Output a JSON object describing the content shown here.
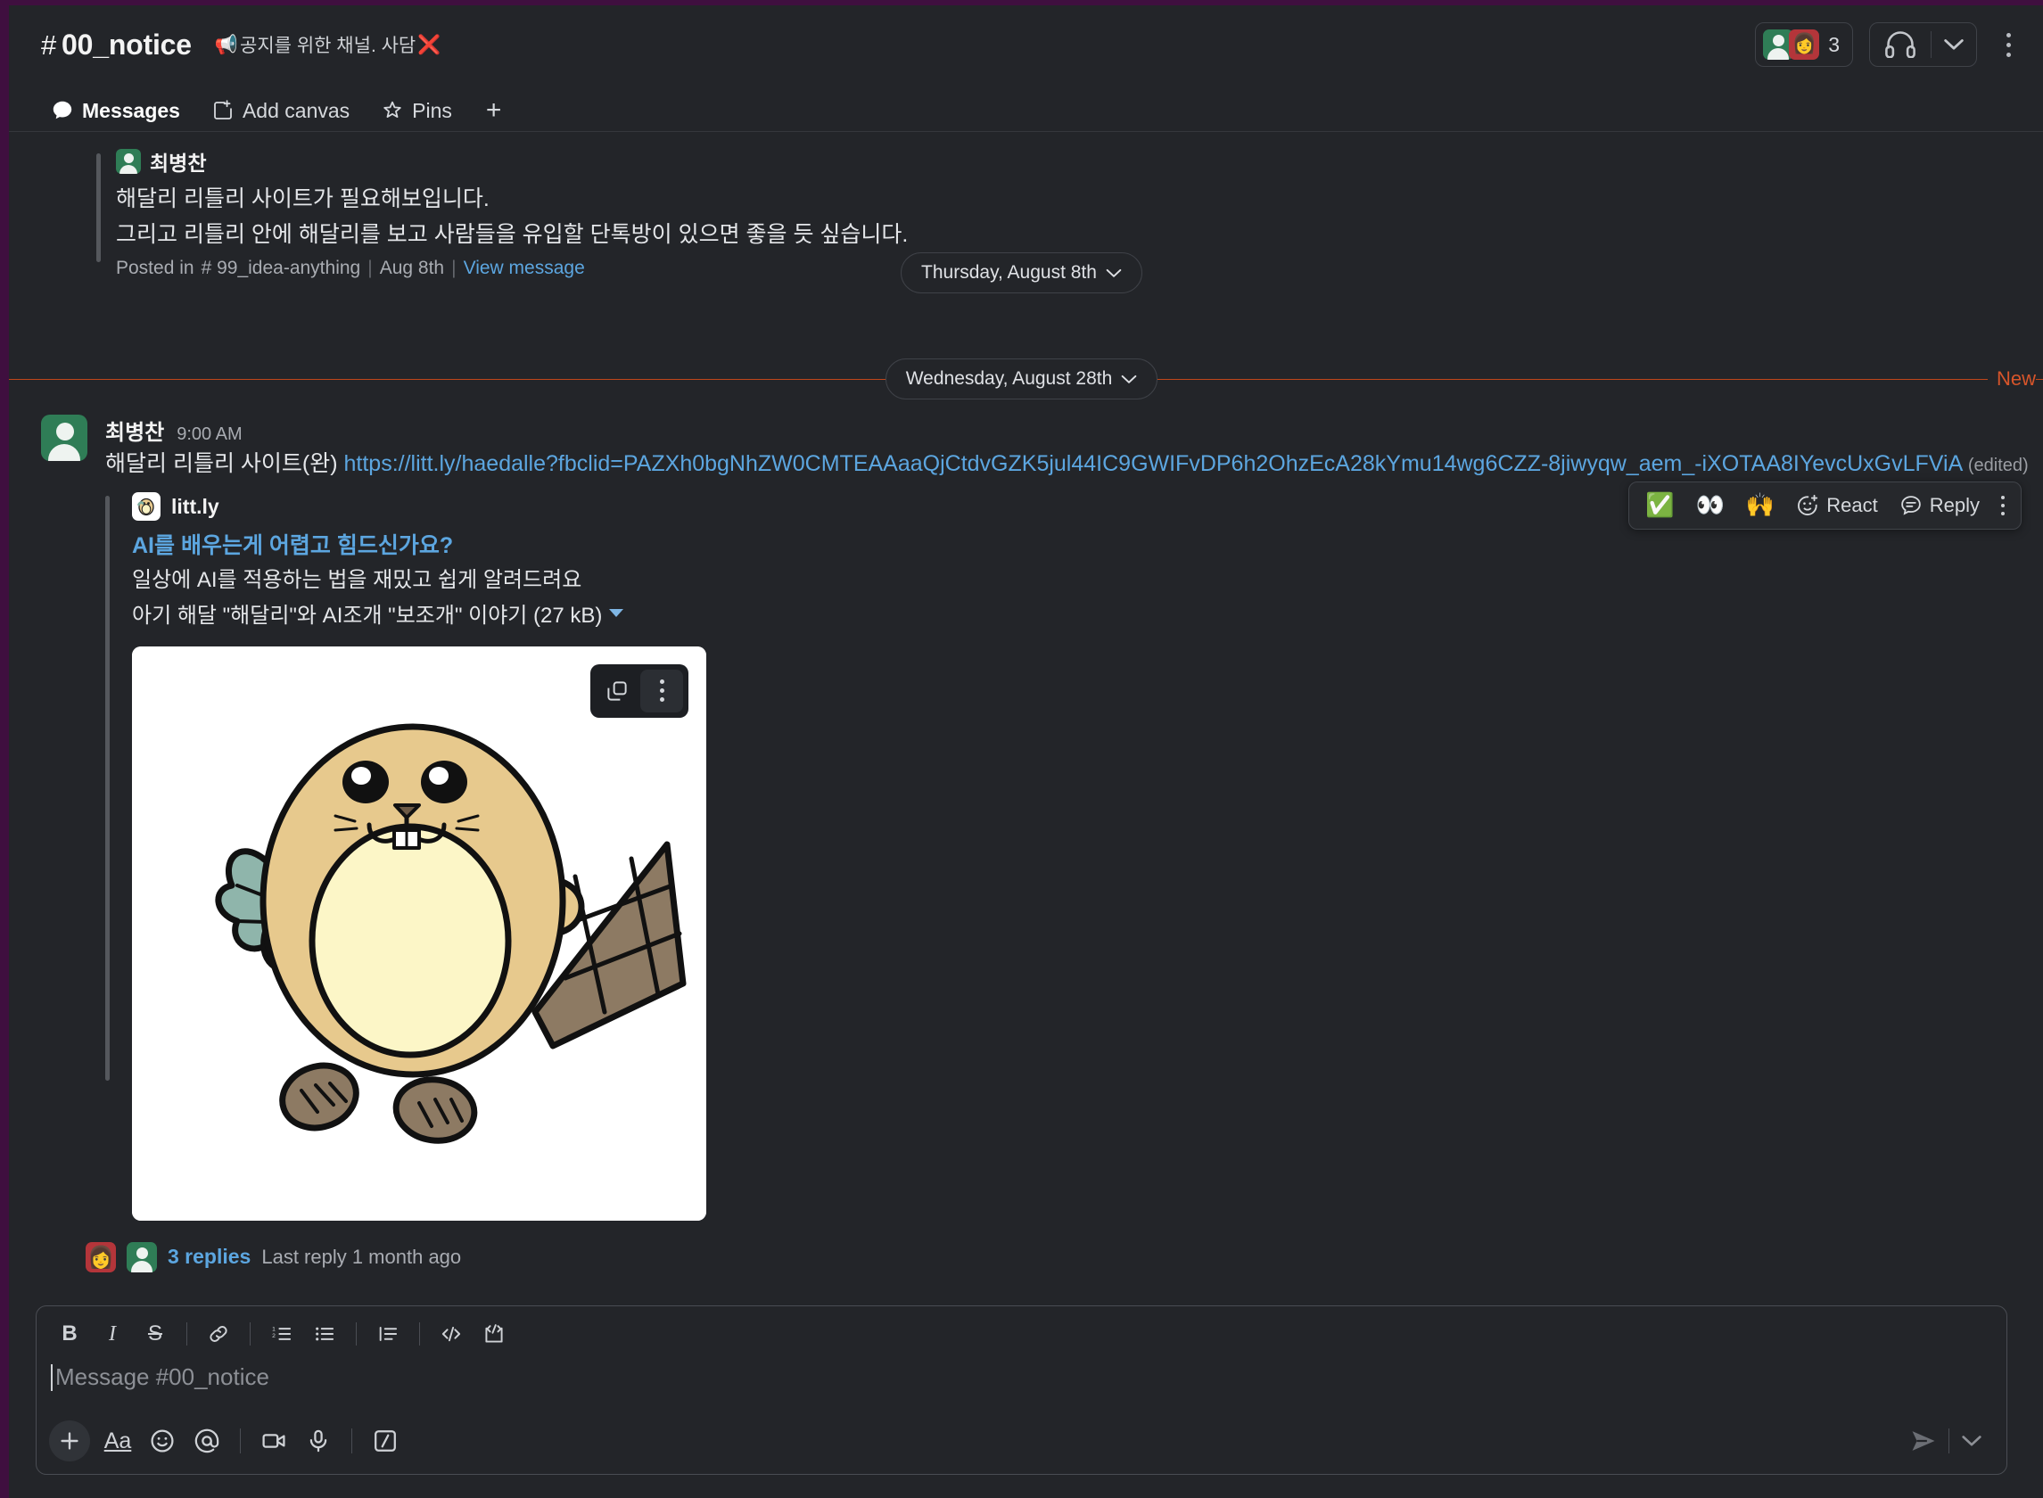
{
  "header": {
    "hash": "#",
    "channel": "00_notice",
    "topic_emoji": "📢",
    "topic": "공지를 위한 채널. 사담",
    "topic_emoji_end": "❌",
    "member_count": "3",
    "huddle_icon": "headphones-icon",
    "more_icon": "kebab-icon"
  },
  "tabs": [
    {
      "label": "Messages",
      "icon": "chat-bubble-icon",
      "active": true
    },
    {
      "label": "Add canvas",
      "icon": "canvas-plus-icon",
      "active": false
    },
    {
      "label": "Pins",
      "icon": "pin-star-icon",
      "active": false
    }
  ],
  "tab_add_label": "+",
  "shared_message": {
    "author": "최병찬",
    "line1": "해달리 리틀리 사이트가 필요해보입니다.",
    "line2": "그리고 리틀리 안에 해달리를 보고 사람들을 유입할 단톡방이 있으면 좋을 듯 싶습니다.",
    "posted_in_prefix": "Posted in",
    "posted_in_hash": "#",
    "posted_in_channel": "99_idea-anything",
    "date": "Aug 8th",
    "view_message": "View message"
  },
  "dividers": {
    "first": "Thursday, August 8th",
    "second": "Wednesday, August 28th",
    "new_label": "New"
  },
  "hover_actions": {
    "emoji1": "✅",
    "emoji2": "👀",
    "emoji3": "🙌",
    "react_label": "React",
    "reply_label": "Reply",
    "more_label": "kebab-icon"
  },
  "message": {
    "author": "최병찬",
    "time": "9:00 AM",
    "text_prefix": "해달리 리틀리 사이트(완) ",
    "url": "https://litt.ly/haedalle?fbclid=PAZXh0bgNhZW0CMTEAAaaQjCtdvGZK5jul44IC9GWIFvDP6h2OhzEcA28kYmu14wg6CZZ-8jiwyqw_aem_-iXOTAA8IYevcUxGvLFViA",
    "edited": "(edited)"
  },
  "unfurl": {
    "service": "litt.ly",
    "service_icon": "otter-favicon",
    "title": "AI를 배우는게 어렵고 힘드신가요?",
    "description": "일상에 AI를 적용하는 법을 재밌고 쉽게 알려드려요",
    "file_line": "아기 해달 \"해달리\"와 AI조개 \"보조개\" 이야기 (27 kB)",
    "collapse_icon": "caret-down-icon",
    "image_alt": "beaver-illustration",
    "image_actions": {
      "copy": "copy-icon",
      "more": "kebab-icon"
    }
  },
  "thread": {
    "avatar1": "👩",
    "avatar2": "person-avatar",
    "replies": "3 replies",
    "last_reply": "Last reply 1 month ago"
  },
  "composer": {
    "placeholder": "Message #00_notice",
    "format_buttons": [
      {
        "name": "bold-button",
        "glyph": "B"
      },
      {
        "name": "italic-button",
        "glyph": "I"
      },
      {
        "name": "strikethrough-button",
        "glyph": "S"
      },
      {
        "name": "link-button",
        "glyph": "link-icon"
      },
      {
        "name": "ordered-list-button",
        "glyph": "ordered-list-icon"
      },
      {
        "name": "bulleted-list-button",
        "glyph": "bulleted-list-icon"
      },
      {
        "name": "blockquote-button",
        "glyph": "blockquote-icon"
      },
      {
        "name": "code-button",
        "glyph": "code-icon"
      },
      {
        "name": "code-block-button",
        "glyph": "code-block-icon"
      }
    ],
    "action_buttons": [
      {
        "name": "add-attachment-button",
        "glyph": "plus-icon"
      },
      {
        "name": "formatting-button",
        "glyph": "Aa"
      },
      {
        "name": "emoji-button",
        "glyph": "smiley-icon"
      },
      {
        "name": "mention-button",
        "glyph": "at-icon"
      },
      {
        "name": "video-clip-button",
        "glyph": "video-icon"
      },
      {
        "name": "audio-clip-button",
        "glyph": "mic-icon"
      },
      {
        "name": "slash-command-button",
        "glyph": "slash-icon"
      }
    ],
    "send_label": "send-icon",
    "send_options_label": "chevron-down-icon"
  },
  "colors": {
    "app_bg": "#232529",
    "accent_purple": "#cdb4d8",
    "link_blue": "#5ca6e0",
    "new_orange": "#c0461a",
    "avatar_green": "#2f7d56",
    "avatar_red": "#b4353a"
  }
}
